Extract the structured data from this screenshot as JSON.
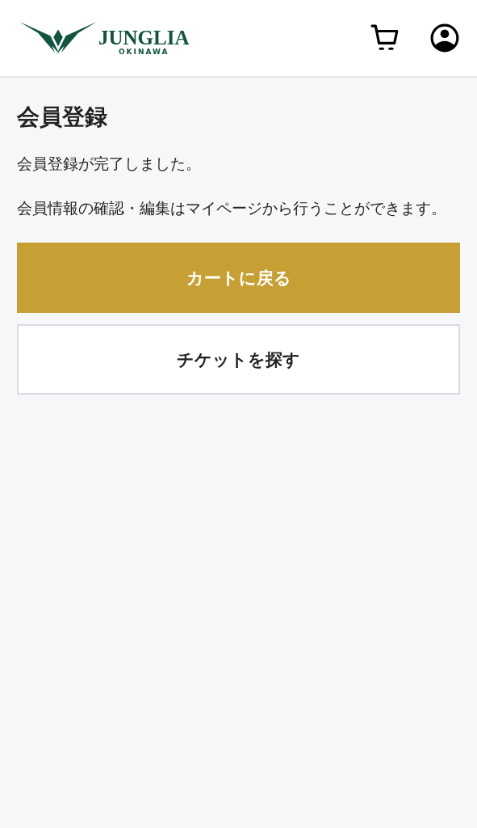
{
  "header": {
    "logo": {
      "name": "JUNGLIA",
      "sub": "OKINAWA"
    }
  },
  "page": {
    "title": "会員登録",
    "paragraphs": [
      "会員登録が完了しました。",
      "会員情報の確認・編集はマイページから行うことができます。"
    ],
    "buttons": [
      {
        "label": "カートに戻る",
        "kind": "primary"
      },
      {
        "label": "チケットを探す",
        "kind": "secondary"
      }
    ]
  }
}
